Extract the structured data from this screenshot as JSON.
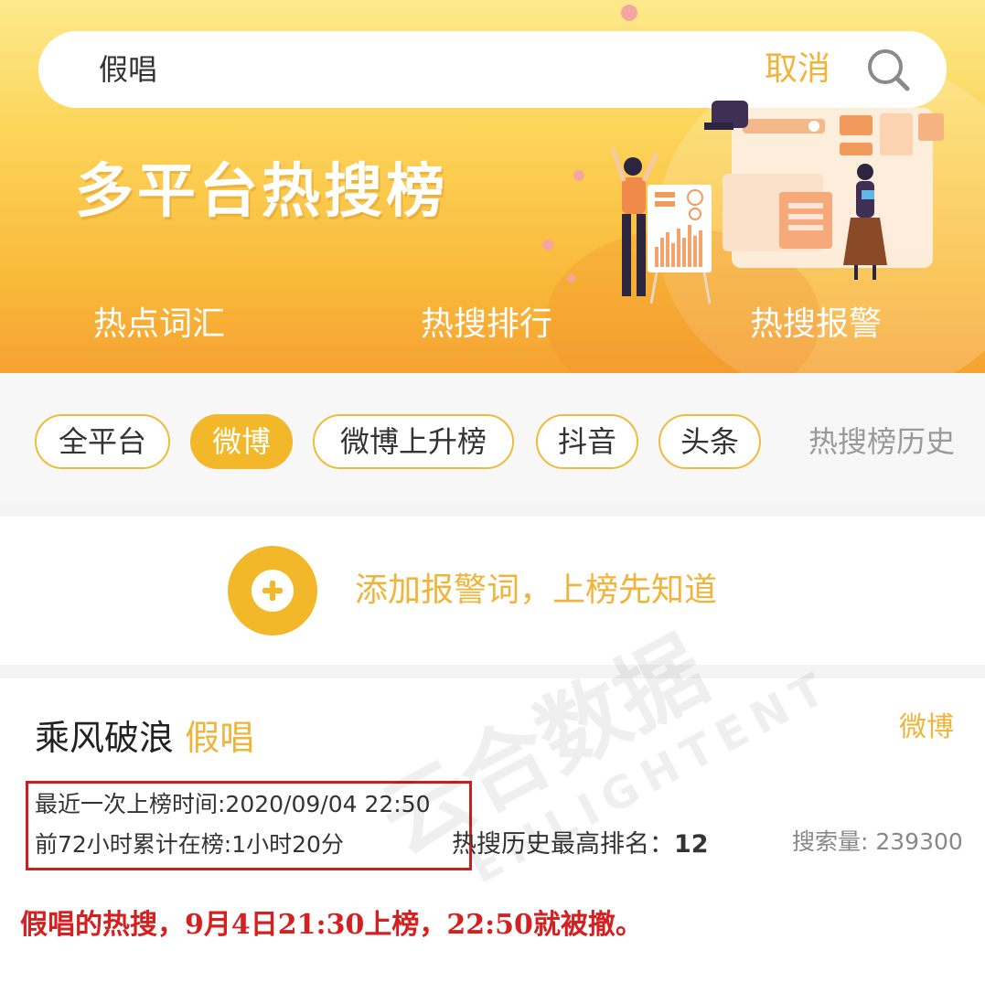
{
  "search": {
    "query": "假唱",
    "cancel_label": "取消"
  },
  "banner": {
    "title": "多平台热搜榜",
    "nav": [
      "热点词汇",
      "热搜排行",
      "热搜报警"
    ]
  },
  "filters": {
    "tabs": [
      {
        "label": "全平台",
        "active": false
      },
      {
        "label": "微博",
        "active": true
      },
      {
        "label": "微博上升榜",
        "active": false
      },
      {
        "label": "抖音",
        "active": false
      },
      {
        "label": "头条",
        "active": false
      }
    ],
    "history_label": "热搜榜历史"
  },
  "alert": {
    "add_text": "添加报警词，上榜先知道"
  },
  "result": {
    "title_prefix": "乘风破浪",
    "title_keyword": "假唱",
    "platform": "微博",
    "last_on_list": "最近一次上榜时间:2020/09/04 22:50",
    "duration_72h": "前72小时累计在榜:1小时20分",
    "highest_rank_label": "热搜历史最高排名：",
    "highest_rank_value": "12",
    "search_volume": "搜索量: 239300"
  },
  "annotation": "假唱的热搜，9月4日21:30上榜，22:50就被撤。",
  "watermark": {
    "cn": "云合数据",
    "en": "ENLIGHTENT"
  },
  "colors": {
    "accent": "#f2b829",
    "accent_text": "#f0b43a",
    "annotation_red": "#d42020",
    "banner_top": "#fde98c",
    "banner_bottom": "#f6a232"
  }
}
